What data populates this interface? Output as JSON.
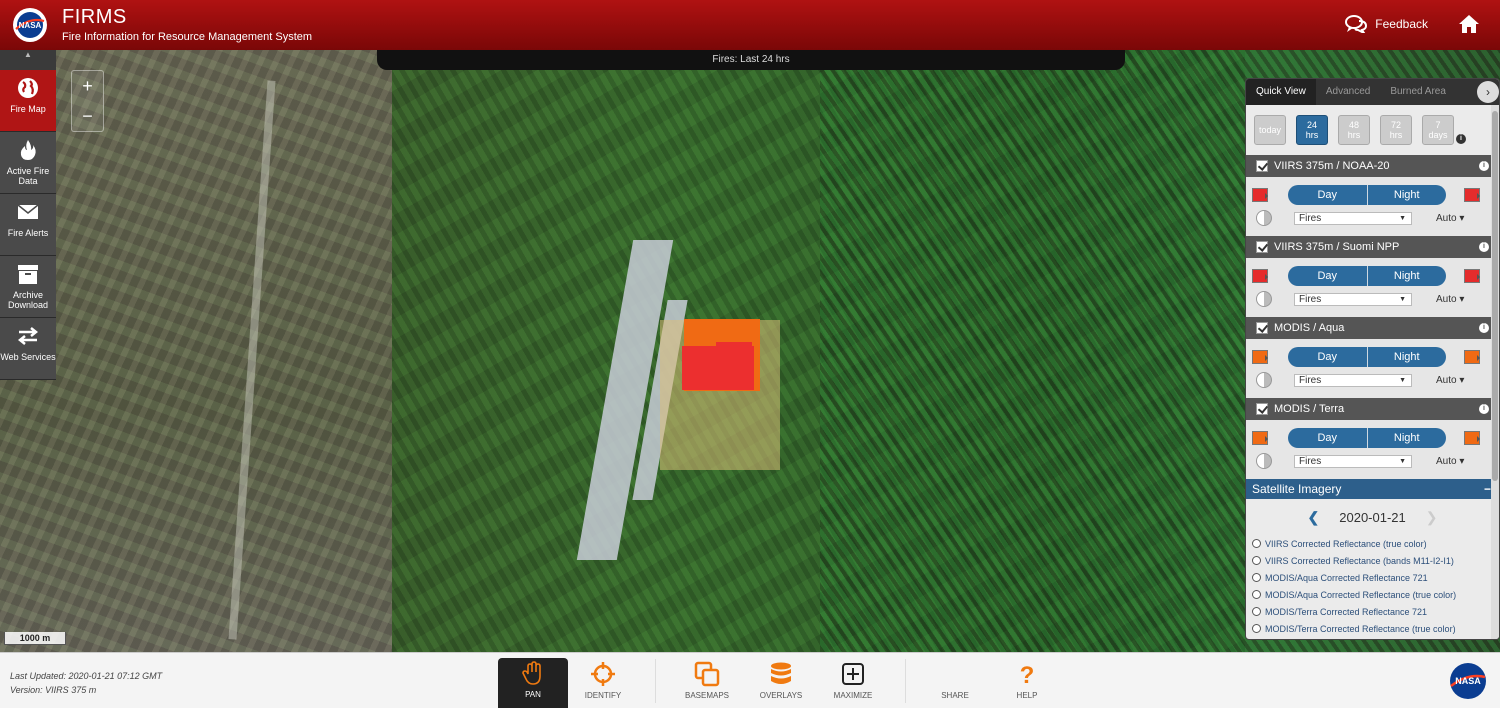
{
  "header": {
    "title": "FIRMS",
    "subtitle": "Fire Information for Resource Management System",
    "feedback_label": "Feedback",
    "logo_text": "NASA"
  },
  "map": {
    "banner": "Fires: Last 24 hrs",
    "zoom_in": "+",
    "zoom_out": "−",
    "scale": "1000 m"
  },
  "left_nav": {
    "scroll_up": "▲",
    "items": [
      {
        "label": "Fire Map",
        "icon": "globe-icon",
        "active": true
      },
      {
        "label": "Active Fire Data",
        "icon": "flame-icon",
        "active": false
      },
      {
        "label": "Fire Alerts",
        "icon": "envelope-icon",
        "active": false
      },
      {
        "label": "Archive Download",
        "icon": "archive-box-icon",
        "active": false
      },
      {
        "label": "Web Services",
        "icon": "exchange-arrows-icon",
        "active": false
      }
    ]
  },
  "panel": {
    "tabs": [
      "Quick View",
      "Advanced",
      "Burned Area"
    ],
    "active_tab": "Quick View",
    "time_options": [
      {
        "l1": "today",
        "l2": ""
      },
      {
        "l1": "24",
        "l2": "hrs"
      },
      {
        "l1": "48",
        "l2": "hrs"
      },
      {
        "l1": "72",
        "l2": "hrs"
      },
      {
        "l1": "7",
        "l2": "days"
      }
    ],
    "active_time": "24 hrs",
    "layers": [
      {
        "name": "VIIRS 375m / NOAA-20",
        "color": "#e52c2c",
        "day": "Day",
        "night": "Night",
        "type": "Fires",
        "size": "Auto"
      },
      {
        "name": "VIIRS 375m / Suomi NPP",
        "color": "#e52c2c",
        "day": "Day",
        "night": "Night",
        "type": "Fires",
        "size": "Auto"
      },
      {
        "name": "MODIS / Aqua",
        "color": "#f06a14",
        "day": "Day",
        "night": "Night",
        "type": "Fires",
        "size": "Auto"
      },
      {
        "name": "MODIS / Terra",
        "color": "#f06a14",
        "day": "Day",
        "night": "Night",
        "type": "Fires",
        "size": "Auto"
      }
    ],
    "satellite": {
      "title": "Satellite Imagery",
      "collapse": "−",
      "date": "2020-01-21",
      "prev": "❮",
      "next": "❯",
      "options": [
        "VIIRS Corrected Reflectance (true color)",
        "VIIRS Corrected Reflectance (bands M11-I2-I1)",
        "MODIS/Aqua Corrected Reflectance 721",
        "MODIS/Aqua Corrected Reflectance (true color)",
        "MODIS/Terra Corrected Reflectance 721",
        "MODIS/Terra Corrected Reflectance (true color)"
      ]
    }
  },
  "footer": {
    "last_updated": "Last Updated: 2020-01-21 07:12 GMT",
    "version": "Version: VIIRS 375 m",
    "tools": [
      {
        "label": "PAN",
        "icon": "hand-icon"
      },
      {
        "label": "IDENTIFY",
        "icon": "crosshair-icon"
      },
      {
        "label": "BASEMAPS",
        "icon": "layers-squares-icon"
      },
      {
        "label": "OVERLAYS",
        "icon": "database-stack-icon"
      },
      {
        "label": "MAXIMIZE",
        "icon": "plus-box-icon"
      },
      {
        "label": "SHARE",
        "icon": "share-icon"
      },
      {
        "label": "HELP",
        "icon": "question-icon"
      }
    ],
    "active_tool": "PAN"
  },
  "colors": {
    "header_red": "#b01212",
    "accent_blue": "#2c6b9e",
    "fire_red": "#e52c2c",
    "fire_orange": "#f06a14",
    "tool_orange": "#f07a10"
  }
}
